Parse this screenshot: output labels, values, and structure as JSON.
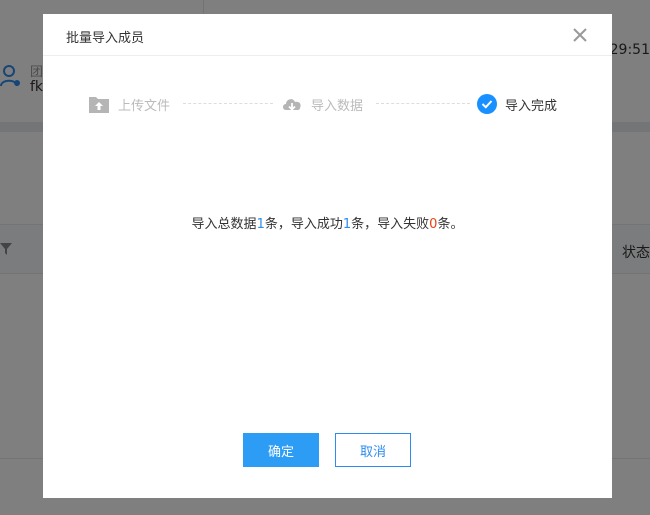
{
  "background": {
    "team_label": "团",
    "team_name": "fk",
    "time": "29:51",
    "table_status_header": "状态"
  },
  "modal": {
    "title": "批量导入成员",
    "steps": [
      {
        "label": "上传文件",
        "icon": "upload-folder-icon",
        "state": "done"
      },
      {
        "label": "导入数据",
        "icon": "cloud-download-icon",
        "state": "done"
      },
      {
        "label": "导入完成",
        "icon": "check-circle-icon",
        "state": "active"
      }
    ],
    "result": {
      "prefix": "导入总数据",
      "total": "1",
      "seg1": "条，导入成功",
      "success": "1",
      "seg2": "条，导入失败",
      "failed": "0",
      "suffix": "条。"
    },
    "confirm_label": "确定",
    "cancel_label": "取消"
  },
  "colors": {
    "primary": "#2d8cf0",
    "danger": "#ed4014",
    "muted": "#bbbbbb"
  }
}
